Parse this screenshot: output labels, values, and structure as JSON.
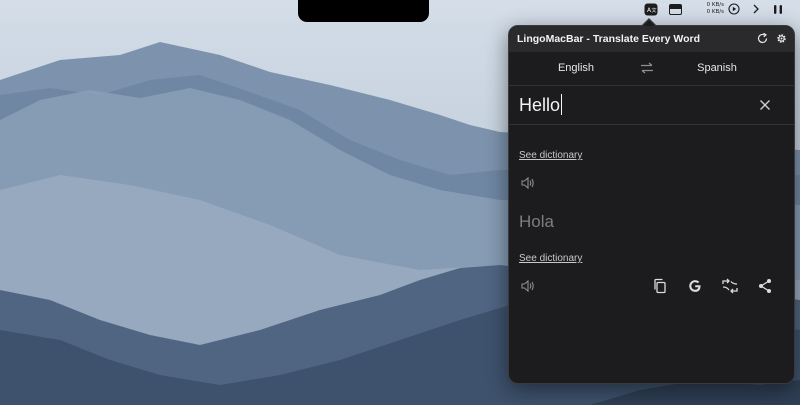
{
  "menubar": {
    "net_speed_up": "0 KB/s",
    "net_speed_down": "0 KB/s",
    "icons": [
      "translate-icon",
      "display-icon",
      "play-circle-icon",
      "chevron-right-icon",
      "airpods-icon"
    ]
  },
  "popover": {
    "title": "LingoMacBar - Translate Every Word",
    "source_language": "English",
    "target_language": "Spanish",
    "input_text": "Hello",
    "source_dictionary_link": "See dictionary",
    "translation": "Hola",
    "target_dictionary_link": "See dictionary",
    "actions": [
      "copy-icon",
      "google-icon",
      "swap-translation-icon",
      "share-icon"
    ]
  },
  "colors": {
    "popover_bg": "#1c1c1e",
    "header_bg": "#2a2a2c",
    "muted_text": "#7d7d82"
  }
}
